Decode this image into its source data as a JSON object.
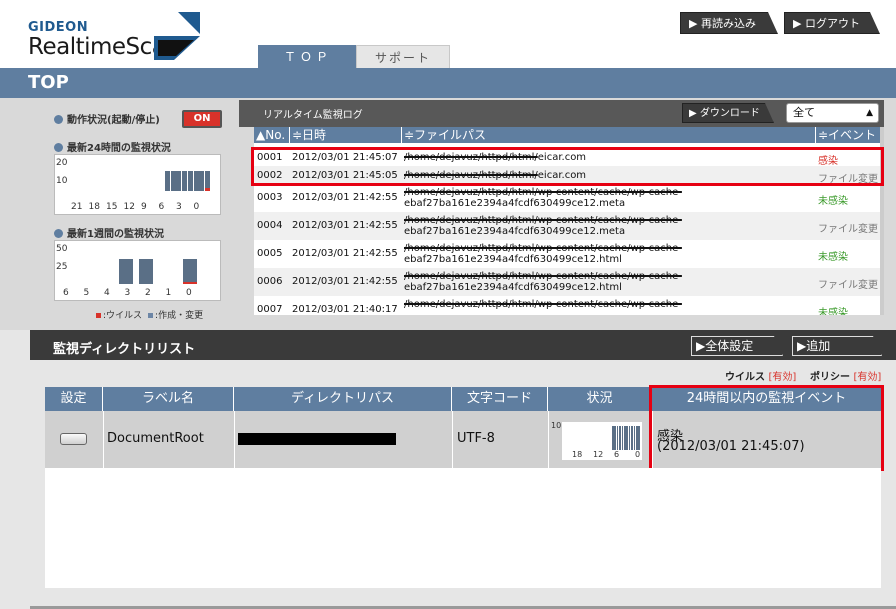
{
  "header": {
    "logo_top": "GIDEON",
    "logo_main": "RealtimeScan",
    "reload_button": "▶ 再読み込み",
    "logout_button": "▶ ログアウト",
    "tabs": [
      {
        "label": "ＴＯＰ",
        "active": true
      },
      {
        "label": "サポート",
        "active": false
      }
    ],
    "page_title": "TOP"
  },
  "sidebar": {
    "operation_label": "動作状況(起動/停止)",
    "operation_state": "ON",
    "chart24_title": "最新24時間の監視状況",
    "chart24_y": [
      "20",
      "10"
    ],
    "chart24_x": [
      "21",
      "18",
      "15",
      "12",
      "9",
      "6",
      "3",
      "0"
    ],
    "chart7_title": "最新1週間の監視状況",
    "chart7_y": [
      "50",
      "25"
    ],
    "chart7_x": [
      "6",
      "5",
      "4",
      "3",
      "2",
      "1",
      "0"
    ],
    "legend_virus": ":ウイルス",
    "legend_change": ":作成・変更"
  },
  "chart_data": [
    {
      "type": "bar",
      "title": "最新24時間の監視状況",
      "x_ticks": [
        "21",
        "18",
        "15",
        "12",
        "9",
        "6",
        "3",
        "0"
      ],
      "series": [
        {
          "name": "作成・変更",
          "values": [
            0,
            0,
            0,
            0,
            0,
            0,
            0,
            0,
            0,
            0,
            0,
            0,
            0,
            0,
            0,
            0,
            0,
            14,
            14,
            14,
            14,
            14,
            14,
            14,
            14
          ]
        },
        {
          "name": "ウイルス",
          "values": [
            0,
            0,
            0,
            0,
            0,
            0,
            0,
            0,
            0,
            0,
            0,
            0,
            0,
            0,
            0,
            0,
            0,
            0,
            0,
            0,
            0,
            0,
            0,
            0,
            1
          ]
        }
      ],
      "ylim": [
        0,
        24
      ]
    },
    {
      "type": "bar",
      "title": "最新1週間の監視状況",
      "categories": [
        "6",
        "5",
        "4",
        "3",
        "2",
        "1",
        "0"
      ],
      "series": [
        {
          "name": "作成・変更",
          "values": [
            0,
            0,
            0,
            33,
            33,
            0,
            33
          ]
        },
        {
          "name": "ウイルス",
          "values": [
            0,
            0,
            0,
            0,
            0,
            0,
            1
          ]
        }
      ],
      "ylim": [
        0,
        50
      ]
    }
  ],
  "log": {
    "title": "リアルタイム監視ログ",
    "download_button": "▶ ダウンロード",
    "filter_value": "全て",
    "columns": [
      "▲No.",
      "≑日時",
      "≑ファイルパス",
      "≑イベント"
    ],
    "rows": [
      {
        "no": "0001",
        "date": "2012/03/01 21:45:07",
        "path1": "/home/dejavuz/httpd/html/",
        "path1b": "eicar.com",
        "path2": "",
        "event": "感染",
        "event_type": "red"
      },
      {
        "no": "0002",
        "date": "2012/03/01 21:45:05",
        "path1": "/home/dejavuz/httpd/html/",
        "path1b": "eicar.com",
        "path2": "",
        "event": "ファイル変更",
        "event_type": "gray"
      },
      {
        "no": "0003",
        "date": "2012/03/01 21:42:55",
        "path1": "/home/dejavuz/httpd/html/wp-content/cache/wp-cache-",
        "path1b": "",
        "path2": "ebaf27ba161e2394a4fcdf630499ce12.meta",
        "event": "未感染",
        "event_type": "green"
      },
      {
        "no": "0004",
        "date": "2012/03/01 21:42:55",
        "path1": "/home/dejavuz/httpd/html/wp-content/cache/wp-cache-",
        "path1b": "",
        "path2": "ebaf27ba161e2394a4fcdf630499ce12.meta",
        "event": "ファイル変更",
        "event_type": "gray"
      },
      {
        "no": "0005",
        "date": "2012/03/01 21:42:55",
        "path1": "/home/dejavuz/httpd/html/wp-content/cache/wp-cache-",
        "path1b": "",
        "path2": "ebaf27ba161e2394a4fcdf630499ce12.html",
        "event": "未感染",
        "event_type": "green"
      },
      {
        "no": "0006",
        "date": "2012/03/01 21:42:55",
        "path1": "/home/dejavuz/httpd/html/wp-content/cache/wp-cache-",
        "path1b": "",
        "path2": "ebaf27ba161e2394a4fcdf630499ce12.html",
        "event": "ファイル変更",
        "event_type": "gray"
      },
      {
        "no": "0007",
        "date": "2012/03/01 21:40:17",
        "path1": "/home/dejavuz/httpd/html/wp-content/cache/wp-cache-",
        "path1b": "",
        "path2": "",
        "event": "未感染",
        "event_type": "green"
      }
    ]
  },
  "dirlist": {
    "title": "監視ディレクトリリスト",
    "global_settings_button": "▶全体設定",
    "add_button": "▶追加",
    "virus_label": "ウイルス",
    "virus_state": "[有効]",
    "policy_label": "ポリシー",
    "policy_state": "[有効]",
    "columns": [
      "設定",
      "ラベル名",
      "ディレクトリパス",
      "文字コード",
      "状況",
      "24時間以内の監視イベント"
    ],
    "row": {
      "label": "DocumentRoot",
      "encoding": "UTF-8",
      "status_y": "10",
      "status_x": [
        "18",
        "12",
        "6",
        "0"
      ],
      "event_line1": "感染",
      "event_line2": "(2012/03/01 21:45:07)"
    }
  },
  "colors": {
    "accent": "#5f7ea0",
    "alert_red": "#e60012",
    "infected_red": "#d8322a",
    "clean_green": "#3a9a2a"
  }
}
